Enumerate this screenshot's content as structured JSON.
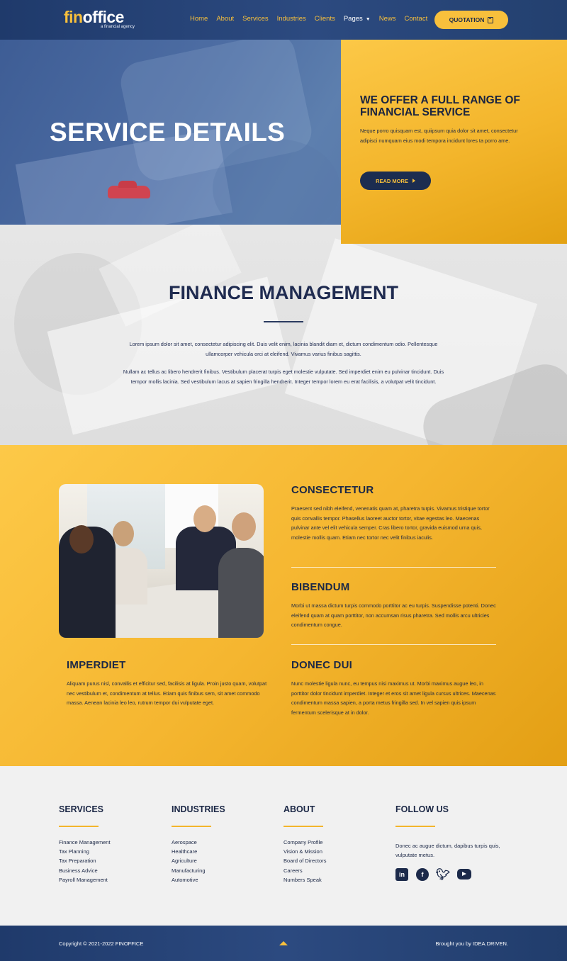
{
  "brand": {
    "name_part1": "fin",
    "name_part2": "office",
    "tagline": "a financial agency"
  },
  "nav": {
    "items": [
      "Home",
      "About",
      "Services",
      "Industries",
      "Clients",
      "Pages",
      "News",
      "Contact"
    ],
    "cta_label": "QUOTATION"
  },
  "hero": {
    "title": "SERVICE DETAILS",
    "offer_title": "WE OFFER A FULL RANGE OF FINANCIAL SERVICE",
    "offer_text": "Neque porro quisquam est, quiipsum quia dolor sit amet, consectetur adipisci numquam eius modi tempora incidunt lores ta porro ame.",
    "read_more": "READ MORE"
  },
  "finance": {
    "title": "FINANCE MANAGEMENT",
    "p1": "Lorem ipsum dolor sit amet, consectetur adipiscing elit. Duis velit enim, lacinia blandit diam et, dictum condimentum odio. Pellentesque ullamcorper vehicula orci at eleifend. Vivamus varius finibus sagittis.",
    "p2": "Nullam ac tellus ac libero hendrerit finibus. Vestibulum placerat turpis eget molestie vulputate. Sed imperdiet enim eu pulvinar tincidunt. Duis tempor mollis lacinia. Sed vestibulum lacus at sapien fringilla hendrerit. Integer tempor lorem eu erat facilisis, a volutpat velit tincidunt."
  },
  "features": [
    {
      "title": "CONSECTETUR",
      "text": "Praesent sed nibh eleifend, venenatis quam at, pharetra turpis. Vivamus tristique tortor quis convallis tempor. Phasellus laoreet auctor tortor, vitae egestas leo. Maecenas pulvinar ante vel elit vehicula semper. Cras libero tortor, gravida euismod urna quis, molestie mollis quam. Etiam nec tortor nec velit finibus iaculis."
    },
    {
      "title": "BIBENDUM",
      "text": "Morbi ut massa dictum turpis commodo porttitor ac eu turpis. Suspendisse potenti. Donec eleifend quam at quam porttitor, non accumsan risus pharetra. Sed mollis arcu ultricies condimentum congue."
    },
    {
      "title": "IMPERDIET",
      "text": "Aliquam purus nisl, convallis et efficitur sed, facilisis at ligula. Proin justo quam, volutpat nec vestibulum et, condimentum at tellus. Etiam quis finibus sem, sit amet commodo massa. Aenean lacinia leo leo, rutrum tempor dui vulputate eget."
    },
    {
      "title": "DONEC DUI",
      "text": "Nunc molestie ligula nunc, eu tempus nisi maximus ut. Morbi maximus augue leo, in porttitor dolor tincidunt imperdiet. Integer et eros sit amet ligula cursus ultrices. Maecenas condimentum massa sapien, a porta metus fringilla sed. In vel sapien quis ipsum fermentum scelerisque at in dolor."
    }
  ],
  "footer": {
    "services": {
      "title": "SERVICES",
      "items": [
        "Finance Management",
        "Tax Planning",
        "Tax Preparation",
        "Business Advice",
        "Payroll Management"
      ]
    },
    "industries": {
      "title": "INDUSTRIES",
      "items": [
        "Aerospace",
        "Healthcare",
        "Agriculture",
        "Manufacturing",
        "Automotive"
      ]
    },
    "about": {
      "title": "ABOUT",
      "items": [
        "Company Profile",
        "Vision & Mission",
        "Board of Directors",
        "Careers",
        "Numbers Speak"
      ]
    },
    "follow": {
      "title": "FOLLOW US",
      "text": "Donec ac augue dictum, dapibus turpis quis, vulputate metus.",
      "icons": [
        "linkedin-icon",
        "facebook-icon",
        "twitter-icon",
        "youtube-icon"
      ]
    },
    "copyright": "Copyright © 2021-2022 FINOFFICE",
    "credit": "Brought you by IDEA.DRIVEN."
  },
  "colors": {
    "navy": "#1f3a6b",
    "accent": "#f8c03c",
    "text_dark": "#1c2846"
  }
}
